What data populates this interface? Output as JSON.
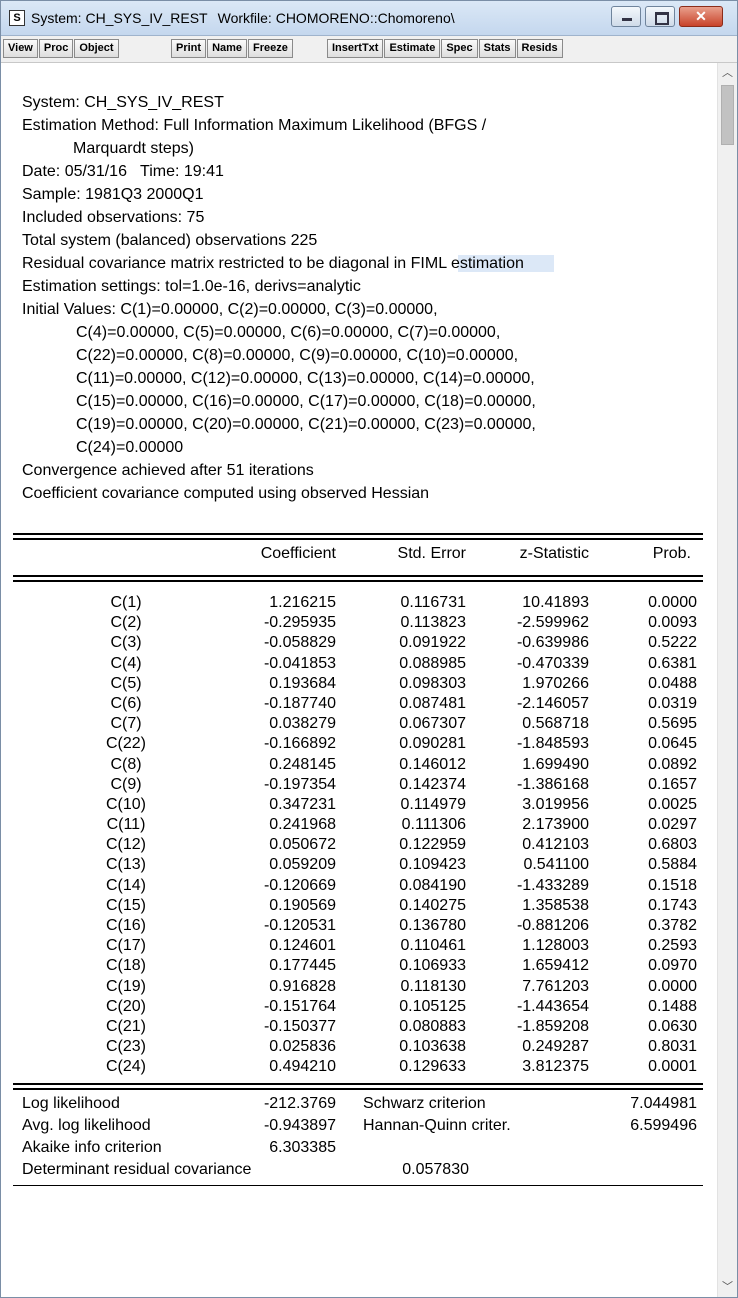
{
  "window": {
    "app_icon": "S",
    "system_label": "System: CH_SYS_IV_REST",
    "workfile_label": "Workfile: CHOMORENO::Chomoreno\\",
    "minimize_icon": "minimize-icon",
    "maximize_icon": "maximize-icon",
    "close_icon": "close-icon"
  },
  "toolbar": {
    "group1": [
      "View",
      "Proc",
      "Object"
    ],
    "group2": [
      "Print",
      "Name",
      "Freeze"
    ],
    "group3": [
      "InsertTxt",
      "Estimate",
      "Spec",
      "Stats",
      "Resids"
    ]
  },
  "header": {
    "system": "System: CH_SYS_IV_REST",
    "method": "Estimation Method: Full Information Maximum Likelihood (BFGS /",
    "method_cont": "Marquardt steps)",
    "date": "Date: 05/31/16   Time: 19:41",
    "sample": "Sample: 1981Q3 2000Q1",
    "included": "Included observations: 75",
    "total": "Total system (balanced) observations 225",
    "residual_note": "Residual covariance matrix restricted to be diagonal in FIML estimation",
    "settings": "Estimation settings: tol=1.0e-16, derivs=analytic",
    "initial_values": [
      "Initial Values: C(1)=0.00000, C(2)=0.00000, C(3)=0.00000,",
      "C(4)=0.00000, C(5)=0.00000, C(6)=0.00000, C(7)=0.00000,",
      "C(22)=0.00000, C(8)=0.00000, C(9)=0.00000, C(10)=0.00000,",
      "C(11)=0.00000, C(12)=0.00000, C(13)=0.00000, C(14)=0.00000,",
      "C(15)=0.00000, C(16)=0.00000, C(17)=0.00000, C(18)=0.00000,",
      "C(19)=0.00000, C(20)=0.00000, C(21)=0.00000, C(23)=0.00000,",
      "C(24)=0.00000"
    ],
    "convergence": "Convergence achieved after 51 iterations",
    "covariance": "Coefficient covariance computed using observed Hessian"
  },
  "table": {
    "columns": [
      "Coefficient",
      "Std. Error",
      "z-Statistic",
      "Prob."
    ],
    "rows": [
      [
        "C(1)",
        "1.216215",
        "0.116731",
        "10.41893",
        "0.0000"
      ],
      [
        "C(2)",
        "-0.295935",
        "0.113823",
        "-2.599962",
        "0.0093"
      ],
      [
        "C(3)",
        "-0.058829",
        "0.091922",
        "-0.639986",
        "0.5222"
      ],
      [
        "C(4)",
        "-0.041853",
        "0.088985",
        "-0.470339",
        "0.6381"
      ],
      [
        "C(5)",
        "0.193684",
        "0.098303",
        "1.970266",
        "0.0488"
      ],
      [
        "C(6)",
        "-0.187740",
        "0.087481",
        "-2.146057",
        "0.0319"
      ],
      [
        "C(7)",
        "0.038279",
        "0.067307",
        "0.568718",
        "0.5695"
      ],
      [
        "C(22)",
        "-0.166892",
        "0.090281",
        "-1.848593",
        "0.0645"
      ],
      [
        "C(8)",
        "0.248145",
        "0.146012",
        "1.699490",
        "0.0892"
      ],
      [
        "C(9)",
        "-0.197354",
        "0.142374",
        "-1.386168",
        "0.1657"
      ],
      [
        "C(10)",
        "0.347231",
        "0.114979",
        "3.019956",
        "0.0025"
      ],
      [
        "C(11)",
        "0.241968",
        "0.111306",
        "2.173900",
        "0.0297"
      ],
      [
        "C(12)",
        "0.050672",
        "0.122959",
        "0.412103",
        "0.6803"
      ],
      [
        "C(13)",
        "0.059209",
        "0.109423",
        "0.541100",
        "0.5884"
      ],
      [
        "C(14)",
        "-0.120669",
        "0.084190",
        "-1.433289",
        "0.1518"
      ],
      [
        "C(15)",
        "0.190569",
        "0.140275",
        "1.358538",
        "0.1743"
      ],
      [
        "C(16)",
        "-0.120531",
        "0.136780",
        "-0.881206",
        "0.3782"
      ],
      [
        "C(17)",
        "0.124601",
        "0.110461",
        "1.128003",
        "0.2593"
      ],
      [
        "C(18)",
        "0.177445",
        "0.106933",
        "1.659412",
        "0.0970"
      ],
      [
        "C(19)",
        "0.916828",
        "0.118130",
        "7.761203",
        "0.0000"
      ],
      [
        "C(20)",
        "-0.151764",
        "0.105125",
        "-1.443654",
        "0.1488"
      ],
      [
        "C(21)",
        "-0.150377",
        "0.080883",
        "-1.859208",
        "0.0630"
      ],
      [
        "C(23)",
        "0.025836",
        "0.103638",
        "0.249287",
        "0.8031"
      ],
      [
        "C(24)",
        "0.494210",
        "0.129633",
        "3.812375",
        "0.0001"
      ]
    ]
  },
  "stats": {
    "log_likelihood_label": "Log likelihood",
    "log_likelihood": "-212.3769",
    "schwarz_label": "Schwarz criterion",
    "schwarz": "7.044981",
    "avg_ll_label": "Avg. log likelihood",
    "avg_ll": "-0.943897",
    "hq_label": "Hannan-Quinn criter.",
    "hq": "6.599496",
    "akaike_label": "Akaike info criterion",
    "akaike": "6.303385",
    "det_label": "Determinant residual covariance",
    "det": "0.057830"
  }
}
